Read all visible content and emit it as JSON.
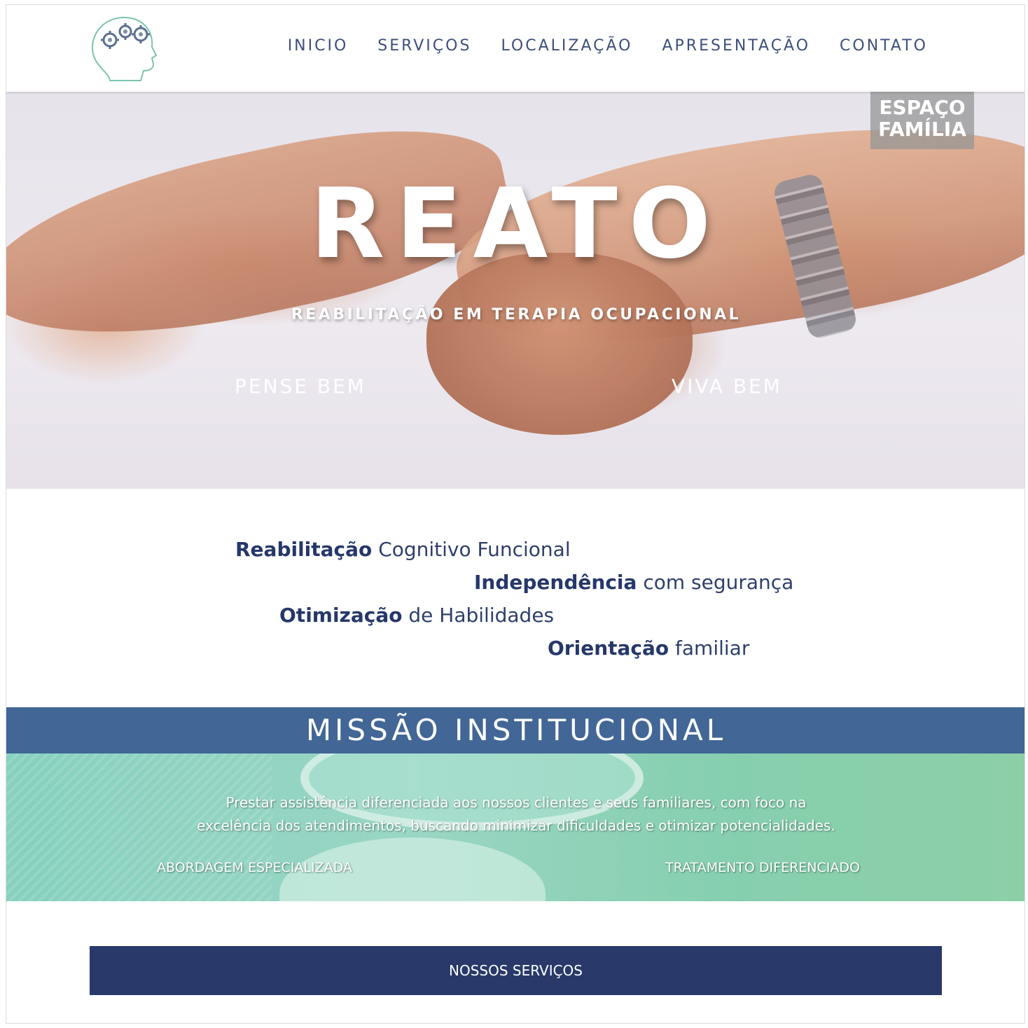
{
  "header": {
    "nav": [
      "INICIO",
      "SERVIÇOS",
      "LOCALIZAÇÃO",
      "APRESENTAÇÃO",
      "CONTATO"
    ],
    "logo_icon": "head-with-gears-icon"
  },
  "hero": {
    "badge_line1": "ESPAÇO",
    "badge_line2": "FAMÍLIA",
    "title": "REATO",
    "subtitle": "REABILITAÇÃO EM TERAPIA OCUPACIONAL",
    "left_tagline": "PENSE BEM",
    "right_tagline": "VIVA BEM"
  },
  "features": [
    {
      "bold": "Reabilitação",
      "rest": " Cognitivo Funcional"
    },
    {
      "bold": "Independência",
      "rest": " com segurança"
    },
    {
      "bold": "Otimização",
      "rest": " de Habilidades"
    },
    {
      "bold": "Orientação",
      "rest": " familiar"
    }
  ],
  "mission": {
    "title": "MISSÃO INSTITUCIONAL",
    "line1": "Prestar assistência diferenciada aos nossos clientes e seus familiares, com foco na",
    "line2": "excelência dos atendimentos, buscando minimizar dificuldades e otimizar potencialidades.",
    "left": "ABORDAGEM ESPECIALIZADA",
    "right": "TRATAMENTO DIFERENCIADO"
  },
  "services_button": "NOSSOS SERVIÇOS",
  "colors": {
    "nav_text": "#3d4f7c",
    "mission_header": "#426696",
    "mission_body": "#8fd2bd",
    "button": "#28396a"
  }
}
